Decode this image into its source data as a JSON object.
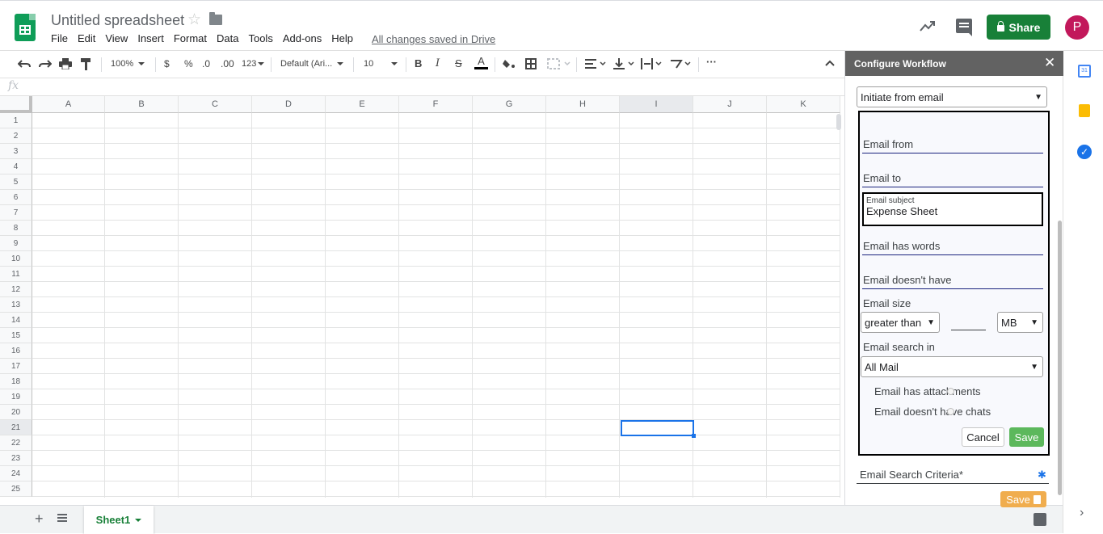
{
  "doc": {
    "title": "Untitled spreadsheet",
    "saved_status": "All changes saved in Drive",
    "menu": [
      "File",
      "Edit",
      "View",
      "Insert",
      "Format",
      "Data",
      "Tools",
      "Add-ons",
      "Help"
    ]
  },
  "header": {
    "share_label": "Share",
    "avatar_letter": "P",
    "brand_color": "#0f9d58",
    "share_color": "#188038"
  },
  "toolbar": {
    "zoom": "100%",
    "currency": "$",
    "percent": "%",
    "decrease_decimal": ".0",
    "increase_decimal": ".00",
    "number_format": "123",
    "font": "Default (Ari...",
    "font_size": "10",
    "bold": "B",
    "italic": "I",
    "strike": "S",
    "text_color": "A",
    "more": "···"
  },
  "formula": {
    "fx": "fx"
  },
  "grid": {
    "columns": [
      "A",
      "B",
      "C",
      "D",
      "E",
      "F",
      "G",
      "H",
      "I",
      "J",
      "K"
    ],
    "rows": [
      "1",
      "2",
      "3",
      "4",
      "5",
      "6",
      "7",
      "8",
      "9",
      "10",
      "11",
      "12",
      "13",
      "14",
      "15",
      "16",
      "17",
      "18",
      "19",
      "20",
      "21",
      "22",
      "23",
      "24",
      "25"
    ],
    "selected_cell": "I21"
  },
  "sheets": {
    "add": "+",
    "active_tab": "Sheet1"
  },
  "panel": {
    "title": "Configure Workflow",
    "close": "✕",
    "trigger_select": "Initiate from email",
    "fields": {
      "email_from": "Email from",
      "email_to": "Email to",
      "email_subject_label": "Email subject",
      "email_subject_value": "Expense Sheet",
      "email_has_words": "Email has words",
      "email_doesnt_have": "Email doesn't have",
      "email_size_label": "Email size",
      "size_comparator": "greater than",
      "size_unit": "MB",
      "search_in_label": "Email search in",
      "search_in_value": "All Mail",
      "has_attachments": "Email has attachments",
      "no_chats": "Email doesn't have chats"
    },
    "cancel_label": "Cancel",
    "save_form_label": "Save",
    "criteria_label": "Email Search Criteria*",
    "save_main_label": "Save"
  }
}
